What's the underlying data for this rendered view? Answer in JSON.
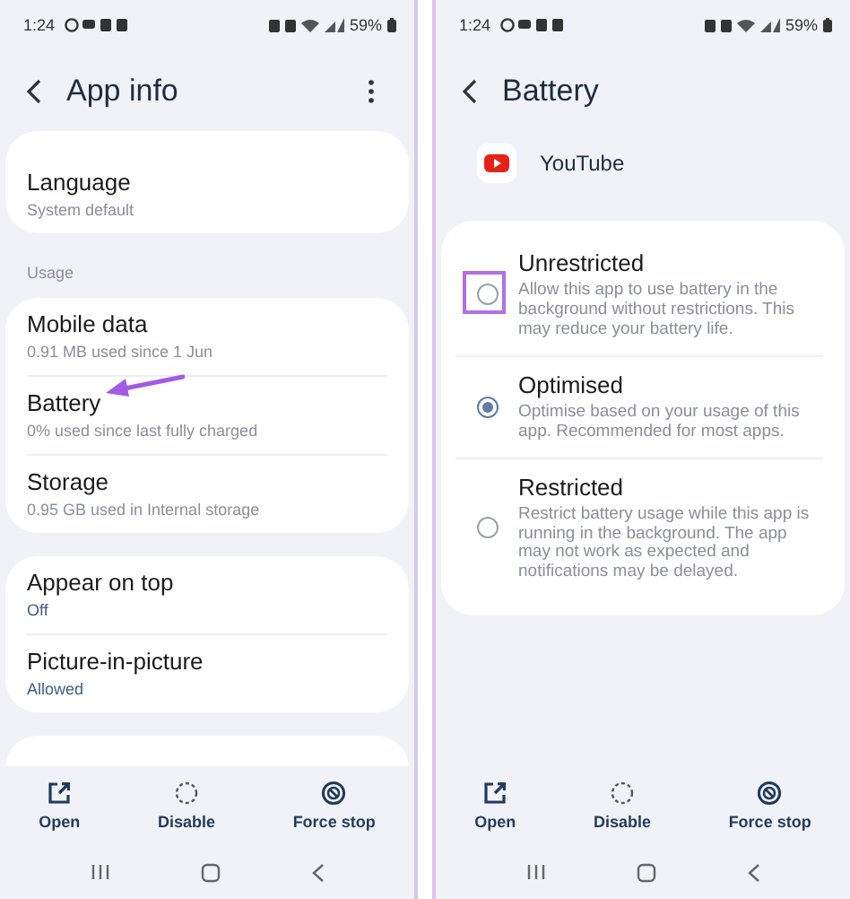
{
  "left_screen": {
    "status_bar": {
      "time": "1:24",
      "battery": "59%"
    },
    "title": "App info",
    "groups": [
      {
        "items": [
          {
            "title": "Language",
            "subtitle": "System default",
            "kind": "summary"
          }
        ]
      },
      {
        "header": "Usage",
        "items": [
          {
            "title": "Mobile data",
            "subtitle": "0.91 MB used since 1 Jun",
            "kind": "summary"
          },
          {
            "title": "Battery",
            "subtitle": "0% used since last fully charged",
            "kind": "summary"
          },
          {
            "title": "Storage",
            "subtitle": "0.95 GB used in Internal storage",
            "kind": "summary"
          }
        ]
      },
      {
        "items": [
          {
            "title": "Appear on top",
            "subtitle": "Off",
            "kind": "value"
          },
          {
            "title": "Picture-in-picture",
            "subtitle": "Allowed",
            "kind": "value"
          }
        ]
      }
    ],
    "actions": [
      {
        "label": "Open"
      },
      {
        "label": "Disable"
      },
      {
        "label": "Force stop"
      }
    ]
  },
  "right_screen": {
    "status_bar": {
      "time": "1:24",
      "battery": "59%"
    },
    "title": "Battery",
    "app_name": "YouTube",
    "options": [
      {
        "title": "Unrestricted",
        "description": "Allow this app to use battery in the background without restrictions. This may reduce your battery life.",
        "selected": false
      },
      {
        "title": "Optimised",
        "description": "Optimise based on your usage of this app. Recommended for most apps.",
        "selected": true
      },
      {
        "title": "Restricted",
        "description": "Restrict battery usage while this app is running in the background. The app may not work as expected and notifications may be delayed.",
        "selected": false
      }
    ],
    "actions": [
      {
        "label": "Open"
      },
      {
        "label": "Disable"
      },
      {
        "label": "Force stop"
      }
    ]
  }
}
